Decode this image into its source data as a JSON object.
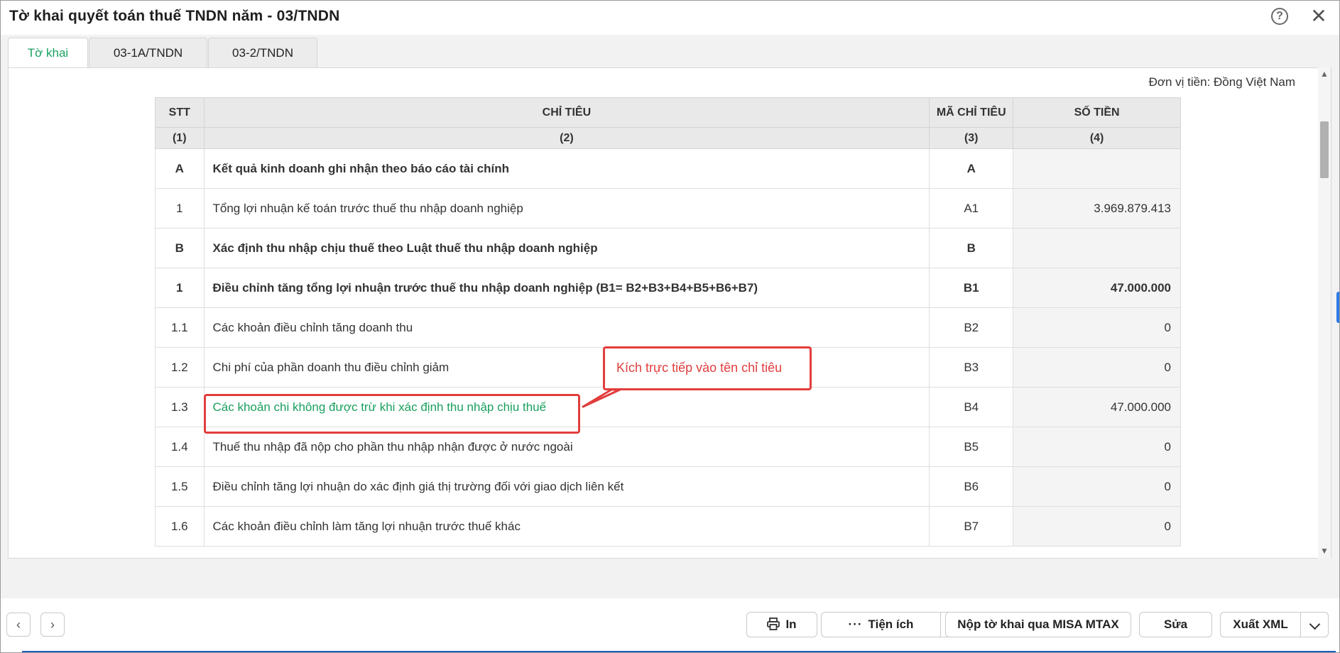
{
  "window": {
    "title": "Tờ khai quyết toán thuế TNDN năm - 03/TNDN"
  },
  "tabs": [
    {
      "label": "Tờ khai",
      "active": true
    },
    {
      "label": "03-1A/TNDN",
      "active": false
    },
    {
      "label": "03-2/TNDN",
      "active": false
    }
  ],
  "unit_label": "Đơn vị tiền: Đồng Việt Nam",
  "table": {
    "headers": {
      "stt": "STT",
      "chi_tieu": "CHỈ TIÊU",
      "ma_chi_tieu": "MÃ CHỈ TIÊU",
      "so_tien": "SỐ TIỀN"
    },
    "subheaders": {
      "stt": "(1)",
      "chi_tieu": "(2)",
      "ma_chi_tieu": "(3)",
      "so_tien": "(4)"
    },
    "rows": [
      {
        "stt": "A",
        "name": "Kết quả kinh doanh ghi nhận theo báo cáo tài chính",
        "code": "A",
        "amount": "",
        "bold": true
      },
      {
        "stt": "1",
        "name": "Tổng lợi nhuận kế toán trước thuế thu nhập doanh nghiệp",
        "code": "A1",
        "amount": "3.969.879.413",
        "bold": false
      },
      {
        "stt": "B",
        "name": "Xác định thu nhập chịu thuế theo Luật thuế thu nhập doanh nghiệp",
        "code": "B",
        "amount": "",
        "bold": true
      },
      {
        "stt": "1",
        "name": "Điều chỉnh tăng tổng lợi nhuận trước thuế thu nhập doanh nghiệp  (B1= B2+B3+B4+B5+B6+B7)",
        "code": "B1",
        "amount": "47.000.000",
        "bold": true
      },
      {
        "stt": "1.1",
        "name": "Các khoản điều chỉnh tăng doanh thu",
        "code": "B2",
        "amount": "0",
        "bold": false
      },
      {
        "stt": "1.2",
        "name": "Chi phí của phần doanh thu điều chỉnh giảm",
        "code": "B3",
        "amount": "0",
        "bold": false
      },
      {
        "stt": "1.3",
        "name": "Các khoản chi không được trừ khi xác định thu nhập chịu thuế",
        "code": "B4",
        "amount": "47.000.000",
        "bold": false,
        "link": true
      },
      {
        "stt": "1.4",
        "name": "Thuế thu nhập đã nộp cho phần thu nhập nhận được ở nước ngoài",
        "code": "B5",
        "amount": "0",
        "bold": false
      },
      {
        "stt": "1.5",
        "name": "Điều chỉnh tăng lợi nhuận do xác định giá thị trường đối với giao dịch liên kết",
        "code": "B6",
        "amount": "0",
        "bold": false
      },
      {
        "stt": "1.6",
        "name": "Các khoản điều chỉnh làm tăng lợi nhuận trước thuế khác",
        "code": "B7",
        "amount": "0",
        "bold": false
      }
    ]
  },
  "callout": {
    "text": "Kích trực tiếp vào tên chỉ tiêu",
    "color": "#e23d3d"
  },
  "footer": {
    "print_label": "In",
    "utilities_label": "Tiện ích",
    "submit_label": "Nộp tờ khai qua MISA MTAX",
    "edit_label": "Sửa",
    "export_label": "Xuất XML"
  },
  "colors": {
    "accent_green": "#1aa260",
    "link_green": "#1a9f5d",
    "annotation_red": "#e23d3d"
  }
}
